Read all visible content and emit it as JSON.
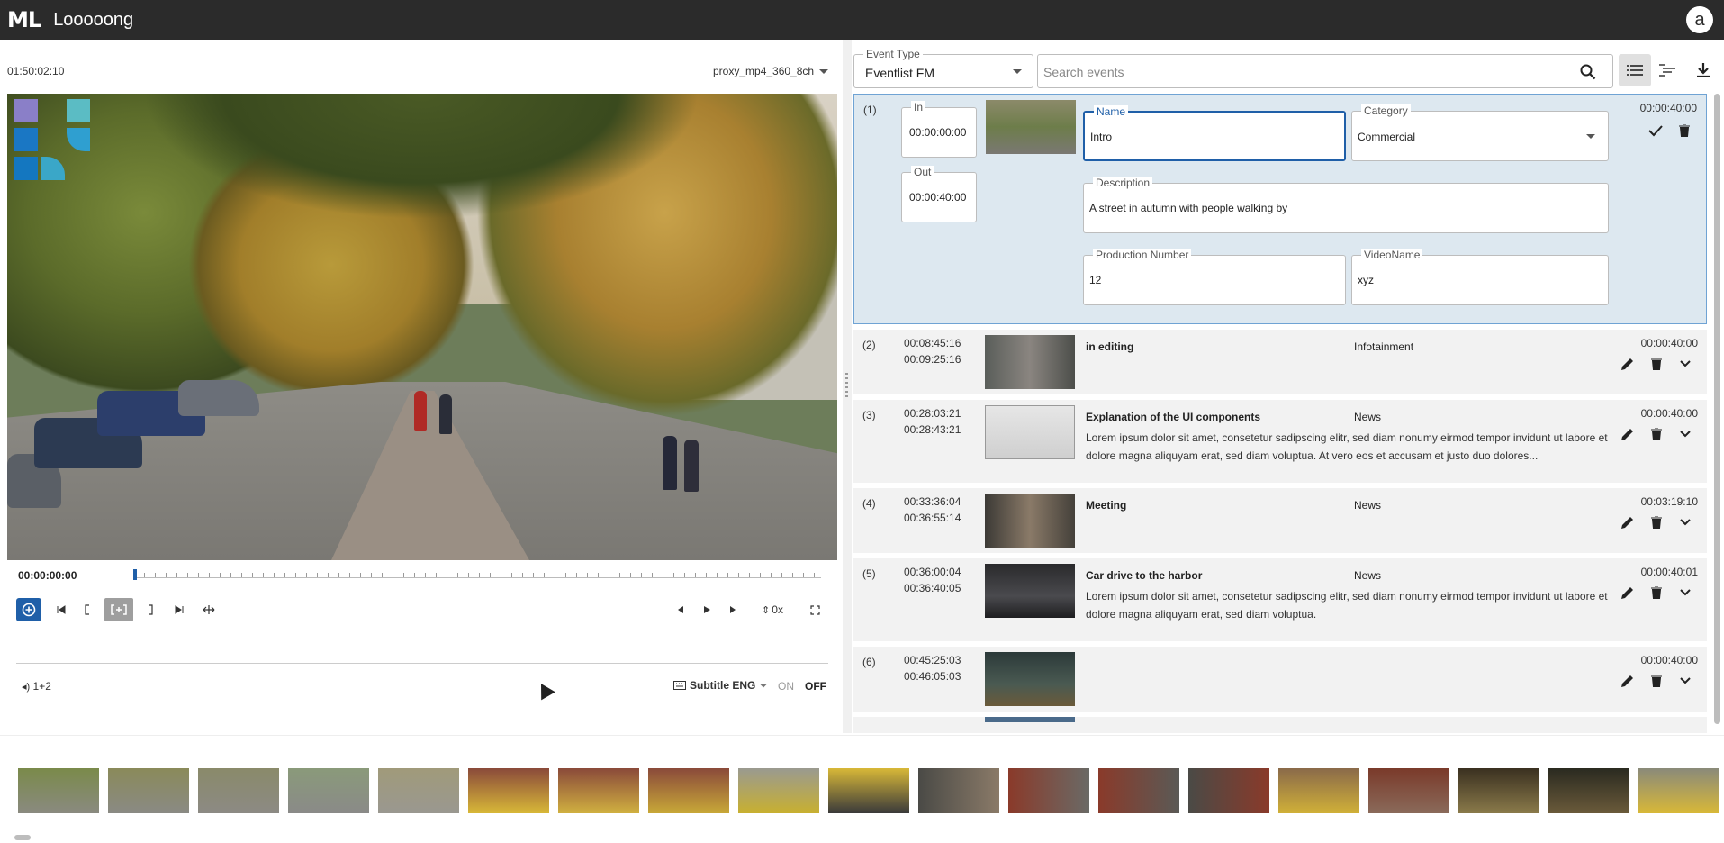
{
  "app": {
    "logo": "ML",
    "title": "Looooong",
    "user_initial": "a"
  },
  "player": {
    "timecode": "01:50:02:10",
    "proxy": "proxy_mp4_360_8ch",
    "position": "00:00:00:00",
    "speed": "0x",
    "audio": "1+2",
    "subtitle": "Subtitle ENG",
    "on": "ON",
    "off": "OFF"
  },
  "panel": {
    "event_type_label": "Event Type",
    "event_type_value": "Eventlist FM",
    "search_placeholder": "Search events"
  },
  "selected": {
    "index": "(1)",
    "in_label": "In",
    "in": "00:00:00:00",
    "out_label": "Out",
    "out": "00:00:40:00",
    "name_label": "Name",
    "name": "Intro",
    "category_label": "Category",
    "category": "Commercial",
    "description_label": "Description",
    "description": "A street in autumn with people walking by",
    "prod_label": "Production Number",
    "prod": "12",
    "video_label": "VideoName",
    "video": "xyz",
    "duration": "00:00:40:00"
  },
  "events": [
    {
      "index": "(2)",
      "in": "00:08:45:16",
      "out": "00:09:25:16",
      "name": "in editing",
      "category": "Infotainment",
      "description": "",
      "duration": "00:00:40:00"
    },
    {
      "index": "(3)",
      "in": "00:28:03:21",
      "out": "00:28:43:21",
      "name": "Explanation of the UI components",
      "category": "News",
      "description": "Lorem ipsum dolor sit amet, consetetur sadipscing elitr, sed diam nonumy eirmod tempor invidunt ut labore et dolore magna aliquyam erat, sed diam voluptua. At vero eos et accusam et justo duo dolores...",
      "duration": "00:00:40:00"
    },
    {
      "index": "(4)",
      "in": "00:33:36:04",
      "out": "00:36:55:14",
      "name": "Meeting",
      "category": "News",
      "description": "",
      "duration": "00:03:19:10"
    },
    {
      "index": "(5)",
      "in": "00:36:00:04",
      "out": "00:36:40:05",
      "name": "Car drive to the harbor",
      "category": "News",
      "description": "Lorem ipsum dolor sit amet, consetetur sadipscing elitr, sed diam nonumy eirmod tempor invidunt ut labore et dolore magna aliquyam erat, sed diam voluptua.",
      "duration": "00:00:40:01"
    },
    {
      "index": "(6)",
      "in": "00:45:25:03",
      "out": "00:46:05:03",
      "name": "",
      "category": "",
      "description": "",
      "duration": "00:00:40:00"
    }
  ],
  "colors": {
    "accent": "#1f5fa8",
    "topbar": "#2b2b2b",
    "selected_row": "#dde8f0"
  }
}
